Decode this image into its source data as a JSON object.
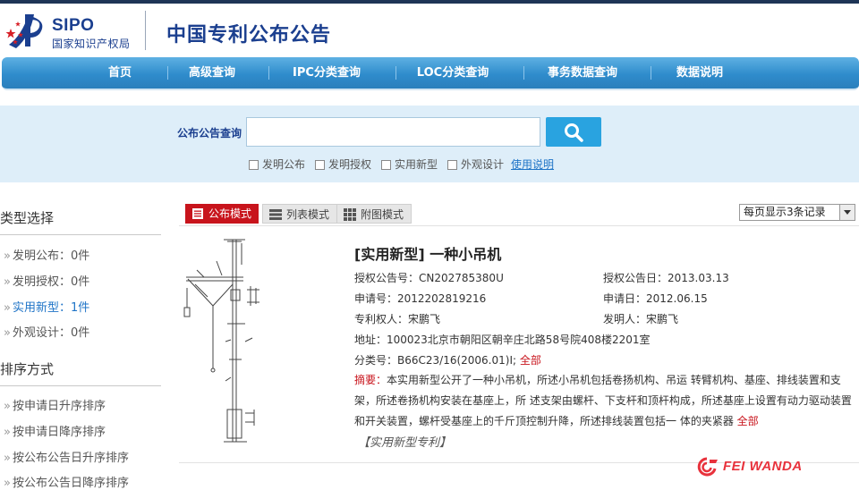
{
  "header": {
    "logo_abbr": "SIPO",
    "logo_name": "国家知识产权局",
    "site_title": "中国专利公布公告"
  },
  "nav": {
    "items": [
      {
        "label": "首页"
      },
      {
        "label": "高级查询"
      },
      {
        "label": "IPC分类查询"
      },
      {
        "label": "LOC分类查询"
      },
      {
        "label": "事务数据查询"
      },
      {
        "label": "数据说明"
      }
    ]
  },
  "search": {
    "label": "公布公告查询",
    "value": "",
    "placeholder": "",
    "options": [
      {
        "label": "发明公布",
        "checked": false
      },
      {
        "label": "发明授权",
        "checked": false
      },
      {
        "label": "实用新型",
        "checked": false
      },
      {
        "label": "外观设计",
        "checked": false
      }
    ],
    "help_link": "使用说明"
  },
  "sidebar": {
    "type_heading": "类型选择",
    "type_items": [
      {
        "label": "发明公布：0件",
        "active": false
      },
      {
        "label": "发明授权：0件",
        "active": false
      },
      {
        "label": "实用新型：1件",
        "active": true
      },
      {
        "label": "外观设计：0件",
        "active": false
      }
    ],
    "sort_heading": "排序方式",
    "sort_items": [
      {
        "label": "按申请日升序排序"
      },
      {
        "label": "按申请日降序排序"
      },
      {
        "label": "按公布公告日升序排序"
      },
      {
        "label": "按公布公告日降序排序"
      }
    ]
  },
  "toolbar": {
    "modes": [
      {
        "label": "公布模式",
        "active": true
      },
      {
        "label": "列表模式",
        "active": false
      },
      {
        "label": "附图模式",
        "active": false
      }
    ],
    "per_page": "每页显示3条记录"
  },
  "record": {
    "title": "[实用新型] 一种小吊机",
    "grant_no": "授权公告号：CN202785380U",
    "grant_date": "授权公告日：2013.03.13",
    "app_no": "申请号：2012202819216",
    "app_date": "申请日：2012.06.15",
    "patentee": "专利权人：宋鹏飞",
    "inventor": "发明人：宋鹏飞",
    "address": "地址：100023北京市朝阳区朝辛庄北路58号院408楼2201室",
    "class_no": "分类号：B66C23/16(2006.01)I;",
    "class_more": "全部",
    "abstract_label": "摘要：",
    "abstract_text": "本实用新型公开了一种小吊机，所述小吊机包括卷扬机构、吊运 转臂机构、基座、排线装置和支架，所述卷扬机构安装在基座上，所 述支架由螺杆、下支杆和顶杆构成，所述基座上设置有动力驱动装置 和开关装置，螺杆受基座上的千斤顶控制升降，所述排线装置包括一 体的夹紧器",
    "abstract_more": "全部",
    "type_label": "【实用新型专利】"
  },
  "watermark": "FEI WANDA",
  "colors": {
    "brand_blue": "#1b3f8f",
    "nav_blue": "#2f8ccc",
    "search_bg": "#deeef9",
    "accent_red": "#c8141c",
    "link_blue": "#1f74c7"
  }
}
